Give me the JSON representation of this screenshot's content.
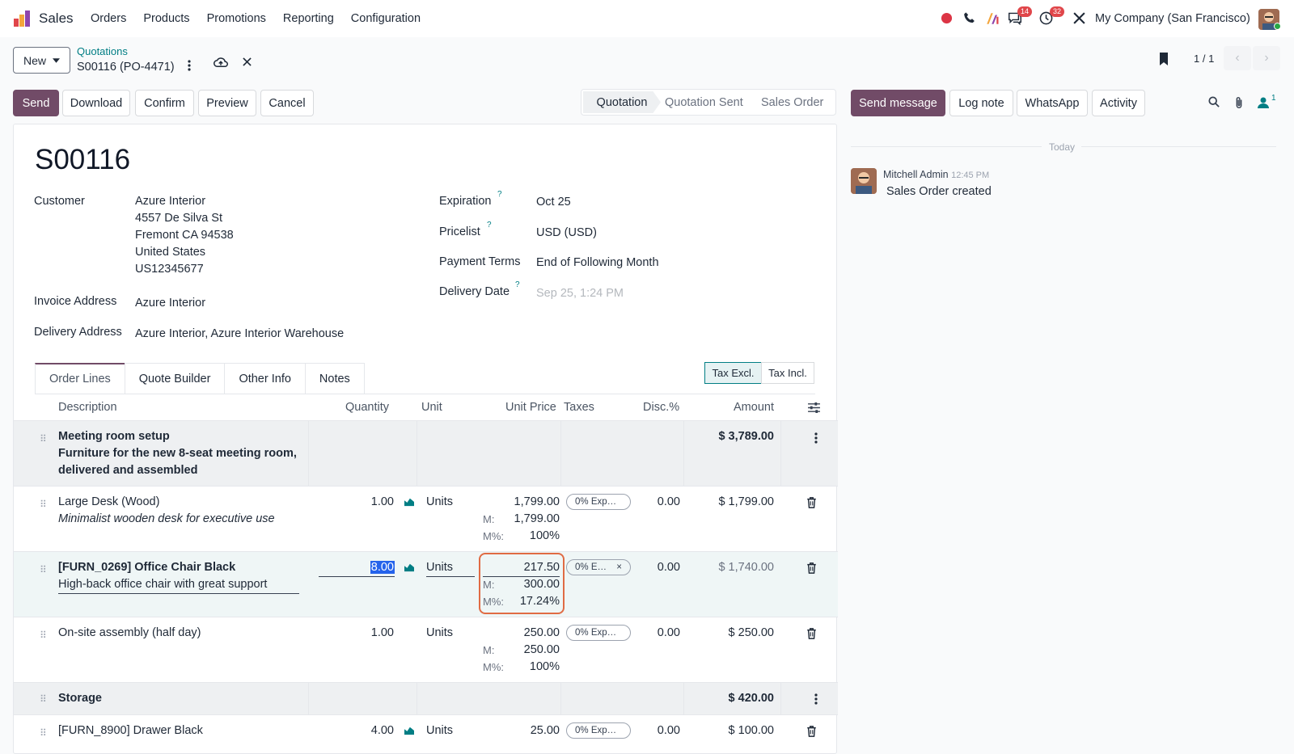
{
  "topbar": {
    "app_name": "Sales",
    "menu": [
      "Orders",
      "Products",
      "Promotions",
      "Reporting",
      "Configuration"
    ],
    "badge_messages": "14",
    "badge_activities": "32",
    "company": "My Company (San Francisco)"
  },
  "control": {
    "new_label": "New",
    "breadcrumb_parent": "Quotations",
    "breadcrumb_current": "S00116 (PO-4471)",
    "pager": "1 / 1"
  },
  "actions": {
    "send": "Send",
    "download": "Download",
    "confirm": "Confirm",
    "preview": "Preview",
    "cancel": "Cancel"
  },
  "status": {
    "stages": [
      "Quotation",
      "Quotation Sent",
      "Sales Order"
    ],
    "active": "Quotation"
  },
  "chatter": {
    "send_message": "Send message",
    "log_note": "Log note",
    "whatsapp": "WhatsApp",
    "activity": "Activity",
    "followers_count": "1",
    "today": "Today",
    "message": {
      "author": "Mitchell Admin",
      "time": "12:45 PM",
      "body": "Sales Order created"
    }
  },
  "form": {
    "title": "S00116",
    "customer_label": "Customer",
    "customer_name": "Azure Interior",
    "customer_street": "4557 De Silva St",
    "customer_city": "Fremont CA 94538",
    "customer_country": "United States",
    "customer_vat": "US12345677",
    "invoice_label": "Invoice Address",
    "invoice_value": "Azure Interior",
    "delivery_label": "Delivery Address",
    "delivery_value": "Azure Interior, Azure Interior Warehouse",
    "expiration_label": "Expiration",
    "expiration_value": "Oct 25",
    "pricelist_label": "Pricelist",
    "pricelist_value": "USD (USD)",
    "terms_label": "Payment Terms",
    "terms_value": "End of Following Month",
    "delivery_date_label": "Delivery Date",
    "delivery_date_placeholder": "Sep 25, 1:24 PM",
    "help_mark": "?"
  },
  "tabs": [
    "Order Lines",
    "Quote Builder",
    "Other Info",
    "Notes"
  ],
  "tax_toggle": {
    "excl": "Tax Excl.",
    "incl": "Tax Incl."
  },
  "table": {
    "headers": {
      "description": "Description",
      "quantity": "Quantity",
      "unit": "Unit",
      "unit_price": "Unit Price",
      "taxes": "Taxes",
      "discount": "Disc.%",
      "amount": "Amount"
    },
    "margin_label": "M:",
    "margin_pct_label": "M%:",
    "section1": {
      "title": "Meeting room setup",
      "desc1": "Furniture for the new 8-seat meeting room,",
      "desc2": "delivered and assembled",
      "amount": "$ 3,789.00"
    },
    "line1": {
      "name": "Large Desk (Wood)",
      "desc": "Minimalist wooden desk for executive use",
      "qty": "1.00",
      "unit": "Units",
      "price": "1,799.00",
      "margin": "1,799.00",
      "margin_pct": "100%",
      "tax": "0% Exp…",
      "disc": "0.00",
      "amount": "$ 1,799.00"
    },
    "line2": {
      "name": "[FURN_0269] Office Chair Black",
      "desc": "High-back office chair with great support",
      "qty": "8.00",
      "unit": "Units",
      "price": "217.50",
      "margin": "300.00",
      "margin_pct": "17.24%",
      "tax": "0% E…",
      "tax_remove": "×",
      "disc": "0.00",
      "amount": "$ 1,740.00"
    },
    "line3": {
      "name": "On-site assembly (half day)",
      "qty": "1.00",
      "unit": "Units",
      "price": "250.00",
      "margin": "250.00",
      "margin_pct": "100%",
      "tax": "0% Exp…",
      "disc": "0.00",
      "amount": "$ 250.00"
    },
    "section2": {
      "title": "Storage",
      "amount": "$ 420.00"
    },
    "line4": {
      "name": "[FURN_8900] Drawer Black",
      "qty": "4.00",
      "unit": "Units",
      "price": "25.00",
      "tax": "0% Exp…",
      "disc": "0.00",
      "amount": "$ 100.00"
    }
  }
}
